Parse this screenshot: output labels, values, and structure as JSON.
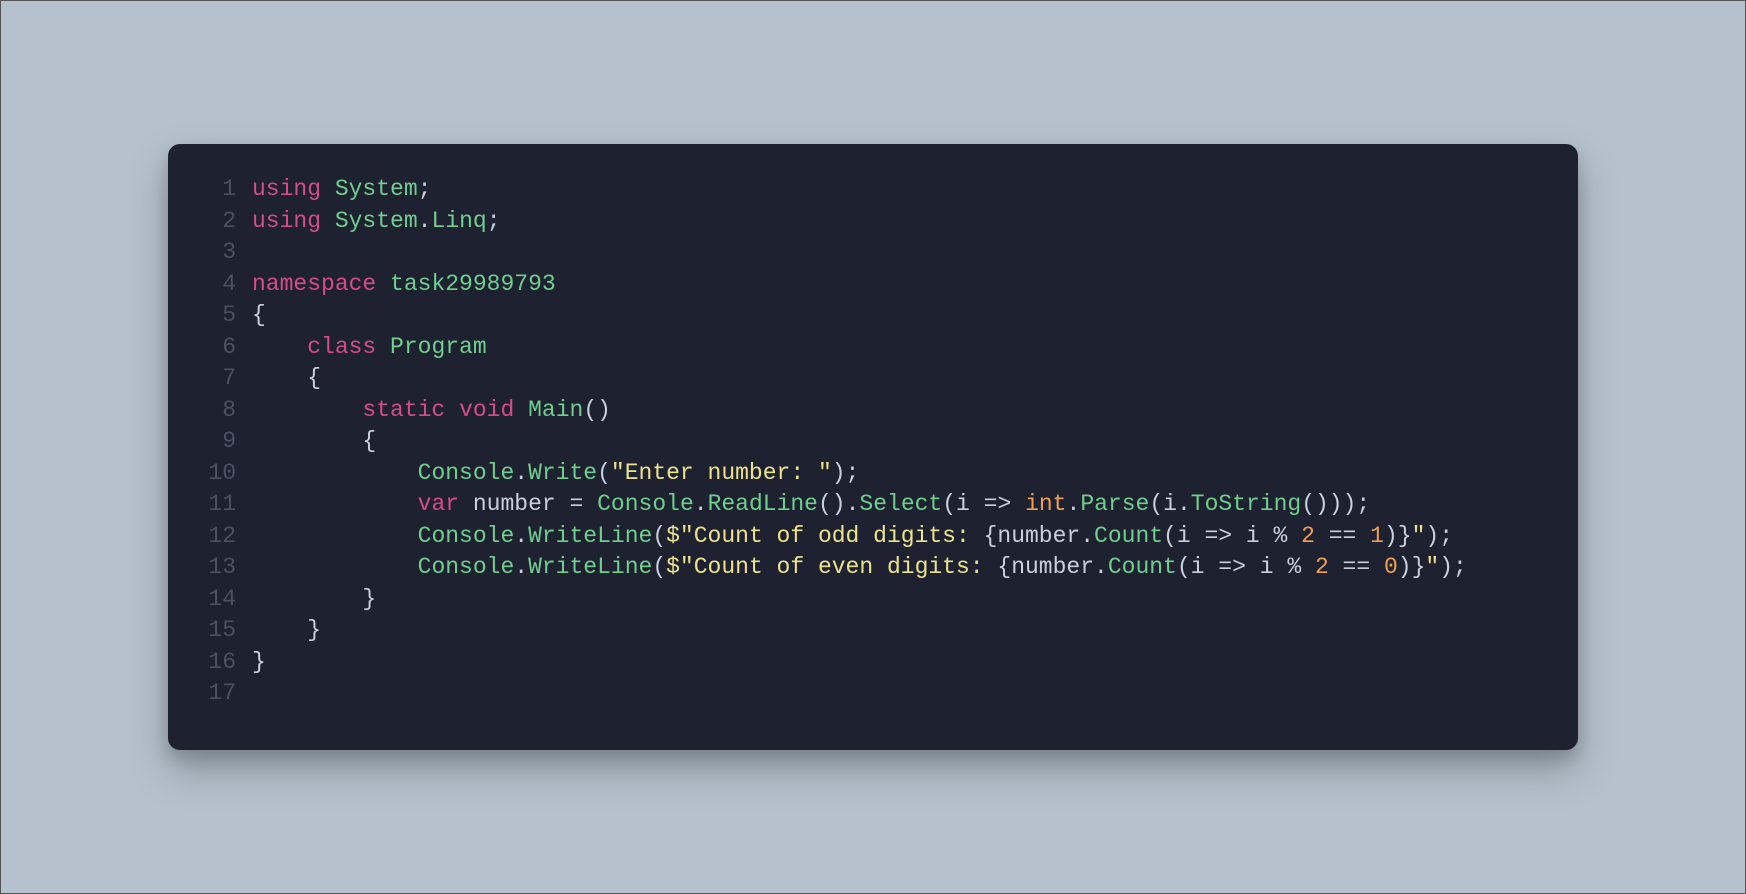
{
  "code": {
    "lines": [
      {
        "n": "1",
        "tokens": [
          {
            "c": "kw",
            "t": "using"
          },
          {
            "c": "op",
            "t": " "
          },
          {
            "c": "typ",
            "t": "System"
          },
          {
            "c": "pun",
            "t": ";"
          }
        ]
      },
      {
        "n": "2",
        "tokens": [
          {
            "c": "kw",
            "t": "using"
          },
          {
            "c": "op",
            "t": " "
          },
          {
            "c": "typ",
            "t": "System"
          },
          {
            "c": "pun",
            "t": "."
          },
          {
            "c": "typ",
            "t": "Linq"
          },
          {
            "c": "pun",
            "t": ";"
          }
        ]
      },
      {
        "n": "3",
        "tokens": []
      },
      {
        "n": "4",
        "tokens": [
          {
            "c": "kw",
            "t": "namespace"
          },
          {
            "c": "op",
            "t": " "
          },
          {
            "c": "typ",
            "t": "task29989793"
          }
        ]
      },
      {
        "n": "5",
        "tokens": [
          {
            "c": "pun",
            "t": "{"
          }
        ]
      },
      {
        "n": "6",
        "tokens": [
          {
            "c": "op",
            "t": "    "
          },
          {
            "c": "kw",
            "t": "class"
          },
          {
            "c": "op",
            "t": " "
          },
          {
            "c": "typ",
            "t": "Program"
          }
        ]
      },
      {
        "n": "7",
        "tokens": [
          {
            "c": "op",
            "t": "    "
          },
          {
            "c": "pun",
            "t": "{"
          }
        ]
      },
      {
        "n": "8",
        "tokens": [
          {
            "c": "op",
            "t": "        "
          },
          {
            "c": "kw",
            "t": "static"
          },
          {
            "c": "op",
            "t": " "
          },
          {
            "c": "kw",
            "t": "void"
          },
          {
            "c": "op",
            "t": " "
          },
          {
            "c": "fn",
            "t": "Main"
          },
          {
            "c": "pun",
            "t": "()"
          }
        ]
      },
      {
        "n": "9",
        "tokens": [
          {
            "c": "op",
            "t": "        "
          },
          {
            "c": "pun",
            "t": "{"
          }
        ]
      },
      {
        "n": "10",
        "tokens": [
          {
            "c": "op",
            "t": "            "
          },
          {
            "c": "typ",
            "t": "Console"
          },
          {
            "c": "pun",
            "t": "."
          },
          {
            "c": "fn",
            "t": "Write"
          },
          {
            "c": "pun",
            "t": "("
          },
          {
            "c": "str",
            "t": "\"Enter number: \""
          },
          {
            "c": "pun",
            "t": ");"
          }
        ]
      },
      {
        "n": "11",
        "tokens": [
          {
            "c": "op",
            "t": "            "
          },
          {
            "c": "kw",
            "t": "var"
          },
          {
            "c": "op",
            "t": " "
          },
          {
            "c": "id",
            "t": "number"
          },
          {
            "c": "op",
            "t": " = "
          },
          {
            "c": "typ",
            "t": "Console"
          },
          {
            "c": "pun",
            "t": "."
          },
          {
            "c": "fn",
            "t": "ReadLine"
          },
          {
            "c": "pun",
            "t": "()."
          },
          {
            "c": "fn",
            "t": "Select"
          },
          {
            "c": "pun",
            "t": "("
          },
          {
            "c": "id",
            "t": "i"
          },
          {
            "c": "op",
            "t": " => "
          },
          {
            "c": "bt",
            "t": "int"
          },
          {
            "c": "pun",
            "t": "."
          },
          {
            "c": "fn",
            "t": "Parse"
          },
          {
            "c": "pun",
            "t": "("
          },
          {
            "c": "id",
            "t": "i"
          },
          {
            "c": "pun",
            "t": "."
          },
          {
            "c": "fn",
            "t": "ToString"
          },
          {
            "c": "pun",
            "t": "()));"
          }
        ]
      },
      {
        "n": "12",
        "tokens": [
          {
            "c": "op",
            "t": "            "
          },
          {
            "c": "typ",
            "t": "Console"
          },
          {
            "c": "pun",
            "t": "."
          },
          {
            "c": "fn",
            "t": "WriteLine"
          },
          {
            "c": "pun",
            "t": "("
          },
          {
            "c": "str",
            "t": "$\"Count of odd digits: "
          },
          {
            "c": "pun",
            "t": "{"
          },
          {
            "c": "id",
            "t": "number"
          },
          {
            "c": "pun",
            "t": "."
          },
          {
            "c": "fn",
            "t": "Count"
          },
          {
            "c": "pun",
            "t": "("
          },
          {
            "c": "id",
            "t": "i"
          },
          {
            "c": "op",
            "t": " => "
          },
          {
            "c": "id",
            "t": "i"
          },
          {
            "c": "op",
            "t": " % "
          },
          {
            "c": "num",
            "t": "2"
          },
          {
            "c": "op",
            "t": " == "
          },
          {
            "c": "num",
            "t": "1"
          },
          {
            "c": "pun",
            "t": ")}"
          },
          {
            "c": "str",
            "t": "\""
          },
          {
            "c": "pun",
            "t": ");"
          }
        ]
      },
      {
        "n": "13",
        "tokens": [
          {
            "c": "op",
            "t": "            "
          },
          {
            "c": "typ",
            "t": "Console"
          },
          {
            "c": "pun",
            "t": "."
          },
          {
            "c": "fn",
            "t": "WriteLine"
          },
          {
            "c": "pun",
            "t": "("
          },
          {
            "c": "str",
            "t": "$\"Count of even digits: "
          },
          {
            "c": "pun",
            "t": "{"
          },
          {
            "c": "id",
            "t": "number"
          },
          {
            "c": "pun",
            "t": "."
          },
          {
            "c": "fn",
            "t": "Count"
          },
          {
            "c": "pun",
            "t": "("
          },
          {
            "c": "id",
            "t": "i"
          },
          {
            "c": "op",
            "t": " => "
          },
          {
            "c": "id",
            "t": "i"
          },
          {
            "c": "op",
            "t": " % "
          },
          {
            "c": "num",
            "t": "2"
          },
          {
            "c": "op",
            "t": " == "
          },
          {
            "c": "num",
            "t": "0"
          },
          {
            "c": "pun",
            "t": ")}"
          },
          {
            "c": "str",
            "t": "\""
          },
          {
            "c": "pun",
            "t": ");"
          }
        ]
      },
      {
        "n": "14",
        "tokens": [
          {
            "c": "op",
            "t": "        "
          },
          {
            "c": "pun",
            "t": "}"
          }
        ]
      },
      {
        "n": "15",
        "tokens": [
          {
            "c": "op",
            "t": "    "
          },
          {
            "c": "pun",
            "t": "}"
          }
        ]
      },
      {
        "n": "16",
        "tokens": [
          {
            "c": "pun",
            "t": "}"
          }
        ]
      },
      {
        "n": "17",
        "tokens": []
      }
    ]
  }
}
